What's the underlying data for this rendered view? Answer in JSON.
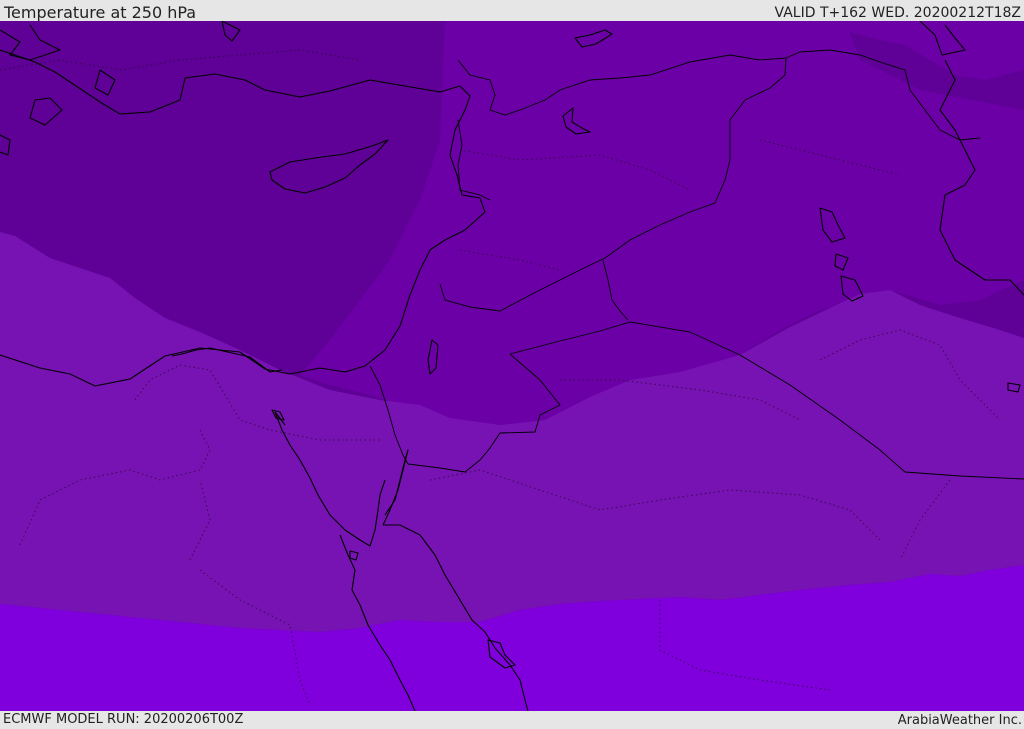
{
  "header": {
    "title": "Temperature at 250 hPa",
    "valid": "VALID T+162 WED. 20200212T18Z"
  },
  "footer": {
    "model_run": "ECMWF MODEL RUN: 20200206T00Z",
    "credit": "ArabiaWeather Inc."
  },
  "map": {
    "region": "Middle East / Eastern Mediterranean",
    "field": "temperature",
    "level": "250 hPa",
    "colors": {
      "band_coldest": "#5f0096",
      "band_cold": "#6b00a6",
      "band_mid": "#7712b3",
      "band_warm": "#7f00dc",
      "coastline": "#000000",
      "header_bg": "#e6e6e6"
    }
  }
}
